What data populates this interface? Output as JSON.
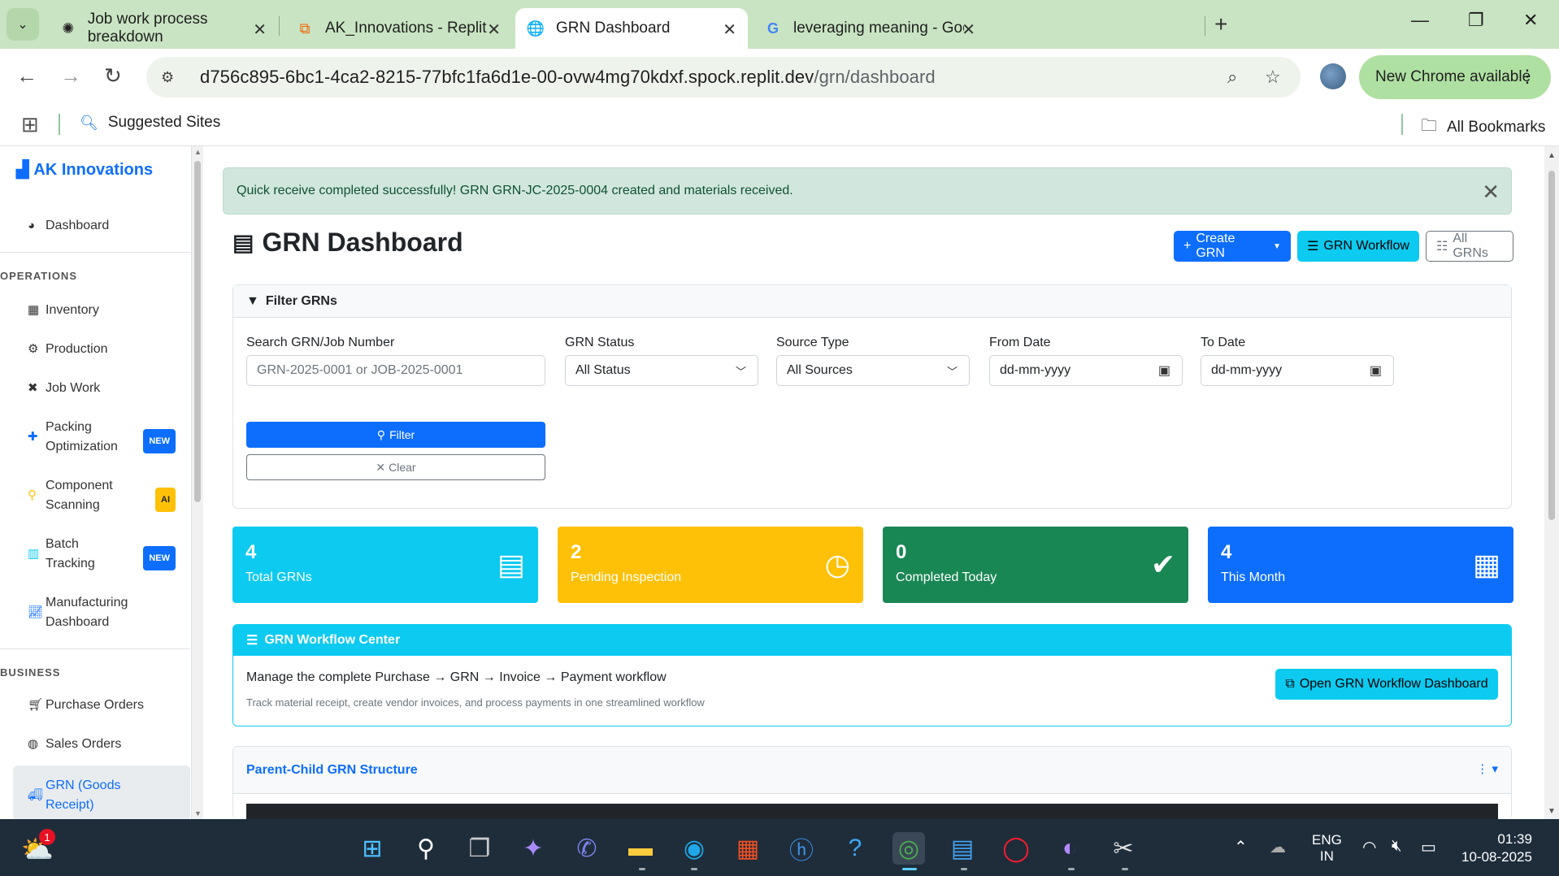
{
  "browser": {
    "tabs": [
      {
        "title": "Job work process breakdown",
        "icon": "chatgpt-icon"
      },
      {
        "title": "AK_Innovations - Replit",
        "icon": "replit-icon"
      },
      {
        "title": "GRN Dashboard",
        "icon": "globe-icon",
        "active": true
      },
      {
        "title": "leveraging meaning - Google S",
        "icon": "google-icon"
      }
    ],
    "url_host": "d756c895-6bc1-4ca2-8215-77bfc1fa6d1e-00-ovw4mg70kdxf.spock.replit.dev",
    "url_path": "/grn/dashboard",
    "update_label": "New Chrome available",
    "bookmarks": {
      "suggested": "Suggested Sites",
      "all": "All Bookmarks"
    }
  },
  "sidebar": {
    "brand": "AK Innovations",
    "dashboard": "Dashboard",
    "sections": {
      "operations": "OPERATIONS",
      "business": "BUSINESS"
    },
    "items": {
      "inventory": "Inventory",
      "production": "Production",
      "job_work": "Job Work",
      "packing_1": "Packing",
      "packing_2": "Optimization",
      "component_1": "Component",
      "component_2": "Scanning",
      "batch_1": "Batch",
      "batch_2": "Tracking",
      "mfg_1": "Manufacturing",
      "mfg_2": "Dashboard",
      "purchase_orders": "Purchase Orders",
      "sales_orders": "Sales Orders",
      "grn_1": "GRN (Goods",
      "grn_2": "Receipt)"
    },
    "badges": {
      "new": "NEW",
      "ai": "AI"
    }
  },
  "alert": {
    "message": "Quick receive completed successfully! GRN GRN-JC-2025-0004 created and materials received."
  },
  "header": {
    "title": "GRN Dashboard",
    "create_grn": "Create GRN",
    "grn_workflow": "GRN Workflow",
    "all_grns": "All GRNs"
  },
  "filter": {
    "heading": "Filter GRNs",
    "search_label": "Search GRN/Job Number",
    "search_placeholder": "GRN-2025-0001 or JOB-2025-0001",
    "status_label": "GRN Status",
    "status_value": "All Status",
    "source_label": "Source Type",
    "source_value": "All Sources",
    "from_label": "From Date",
    "from_value": "dd-mm-yyyy",
    "to_label": "To Date",
    "to_value": "dd-mm-yyyy",
    "filter_btn": "Filter",
    "clear_btn": "Clear"
  },
  "stats": {
    "total": {
      "value": "4",
      "label": "Total GRNs"
    },
    "pending": {
      "value": "2",
      "label": "Pending Inspection"
    },
    "completed": {
      "value": "0",
      "label": "Completed Today"
    },
    "month": {
      "value": "4",
      "label": "This Month"
    }
  },
  "workflow": {
    "heading": "GRN Workflow Center",
    "text": "Manage the complete Purchase → GRN → Invoice → Payment workflow",
    "sub": "Track material receipt, create vendor invoices, and process payments in one streamlined workflow",
    "button": "Open GRN Workflow Dashboard"
  },
  "parent_child": {
    "heading": "Parent-Child GRN Structure"
  },
  "taskbar": {
    "notif_count": "1",
    "lang_1": "ENG",
    "lang_2": "IN",
    "time": "01:39",
    "date": "10-08-2025"
  },
  "colors": {
    "primary": "#0d6efd",
    "info": "#0dcaf0",
    "warning": "#ffc107",
    "success": "#198754",
    "alert_bg": "#d1e7dd"
  }
}
